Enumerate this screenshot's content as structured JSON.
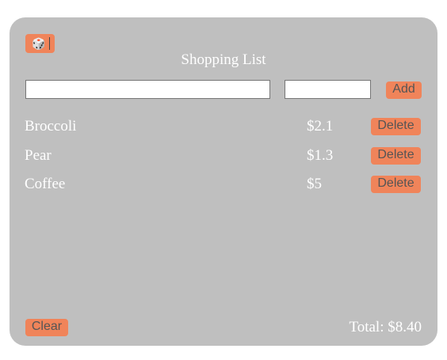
{
  "app": {
    "title": "Shopping List",
    "dice_icon": "🎲"
  },
  "form": {
    "name_value": "",
    "price_value": "",
    "add_label": "Add"
  },
  "items": [
    {
      "name": "Broccoli",
      "price": "$2.1",
      "delete_label": "Delete"
    },
    {
      "name": "Pear",
      "price": "$1.3",
      "delete_label": "Delete"
    },
    {
      "name": "Coffee",
      "price": "$5",
      "delete_label": "Delete"
    }
  ],
  "footer": {
    "clear_label": "Clear",
    "total": "Total: $8.40"
  },
  "colors": {
    "card_background": "#bfbfbf",
    "button_accent": "#f0845a",
    "button_text": "#555555",
    "text": "#ffffff"
  }
}
